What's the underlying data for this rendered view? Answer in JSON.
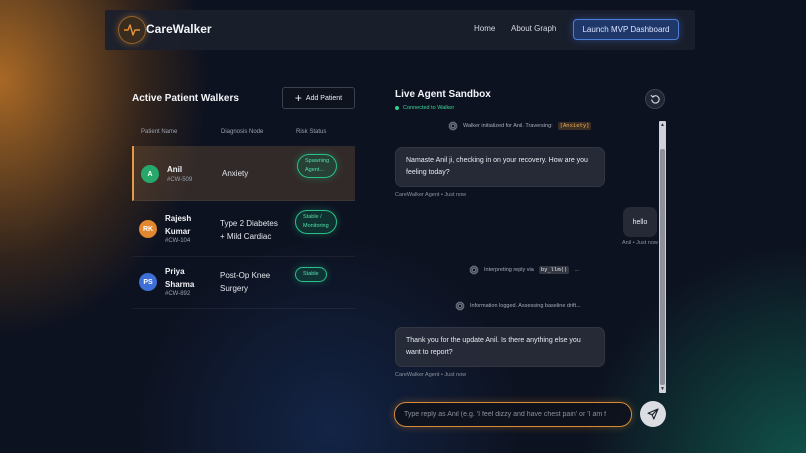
{
  "nav": {
    "brand": "CareWalker",
    "links": [
      "Home",
      "About Graph"
    ],
    "cta": "Launch MVP Dashboard"
  },
  "patients_panel": {
    "title": "Active Patient Walkers",
    "add_button": "Add Patient",
    "columns": [
      "Patient Name",
      "Diagnosis Node",
      "Risk Status"
    ],
    "rows": [
      {
        "initials": "A",
        "name_lines": [
          "Anil"
        ],
        "id": "#CW-509",
        "diagnosis_lines": [
          "Anxiety"
        ],
        "status_lines": [
          "Spawning",
          "Agent..."
        ],
        "avatar_color": "#27a86b",
        "active": true
      },
      {
        "initials": "RK",
        "name_lines": [
          "Rajesh",
          "Kumar"
        ],
        "id": "#CW-104",
        "diagnosis_lines": [
          "Type 2 Diabetes",
          "+ Mild Cardiac"
        ],
        "status_lines": [
          "Stable /",
          "Monitoring"
        ],
        "avatar_color": "#e0872f",
        "active": false
      },
      {
        "initials": "PS",
        "name_lines": [
          "Priya",
          "Sharma"
        ],
        "id": "#CW-892",
        "diagnosis_lines": [
          "Post-Op Knee",
          "Surgery"
        ],
        "status_lines": [
          "Stable"
        ],
        "avatar_color": "#3e6fd6",
        "active": false
      }
    ]
  },
  "sandbox": {
    "title": "Live Agent Sandbox",
    "status": "Connected to Walker",
    "status_color": "#2fd08c",
    "messages": {
      "sys1_text": "Walker initialized for Anil. Traversing:",
      "sys1_code": "[Anxiety]",
      "agent1": "Namaste Anil ji, checking in on your recovery. How are you feeling today?",
      "agent1_meta": "CareWalker Agent • Just now",
      "user1": "hello",
      "user1_meta": "Anil • Just now",
      "sys2_text": "Interpreting reply via",
      "sys2_code": "by_llm()",
      "sys2_suffix": "...",
      "sys3_text": "Information logged. Assessing baseline drift...",
      "agent2": "Thank you for the update Anil. Is there anything else you want to report?",
      "agent2_meta": "CareWalker Agent • Just now"
    },
    "input_placeholder": "Type reply as Anil (e.g. 'I feel dizzy and have chest pain' or 'I am f",
    "accent": "#d98a34"
  }
}
